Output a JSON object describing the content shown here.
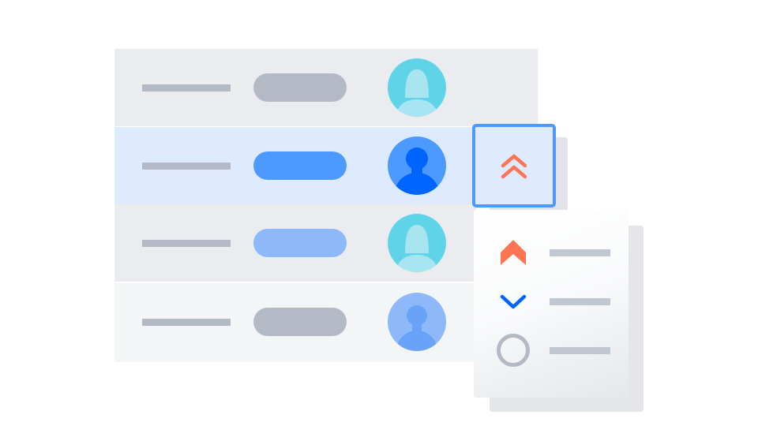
{
  "colors": {
    "row_grey": "#EBECF0",
    "row_selected": "#DEEBFF",
    "row_light": "#F4F5F7",
    "text_placeholder": "#B3BAC5",
    "pill_grey": "#B3BAC5",
    "pill_blue": "#4C9AFF",
    "pill_light_blue": "#8DB9FB",
    "focus_border": "#4C9AFF",
    "priority_high": "#FF7452",
    "priority_low": "#0065FF",
    "priority_none": "#B3BAC5"
  },
  "rows": [
    {
      "state": "default",
      "avatar": "female-user-avatar-icon",
      "avatar_color": "#5FD4E8",
      "pill_color": "#B3BAC5"
    },
    {
      "state": "selected",
      "avatar": "male-user-avatar-icon",
      "avatar_color": "#0065FF",
      "pill_color": "#4C9AFF"
    },
    {
      "state": "default",
      "avatar": "female-user-avatar-icon",
      "avatar_color": "#5FD4E8",
      "pill_color": "#8DB9FB"
    },
    {
      "state": "default",
      "avatar": "user-avatar-icon",
      "avatar_color": "#7AB0FF",
      "pill_color": "#B3BAC5"
    }
  ],
  "priority_selector": {
    "current_icon": "double-chevron-up-icon",
    "options": [
      {
        "icon": "arrow-up-icon",
        "color": "#FF7452"
      },
      {
        "icon": "chevron-down-icon",
        "color": "#0065FF"
      },
      {
        "icon": "circle-icon",
        "color": "#B3BAC5"
      }
    ]
  }
}
